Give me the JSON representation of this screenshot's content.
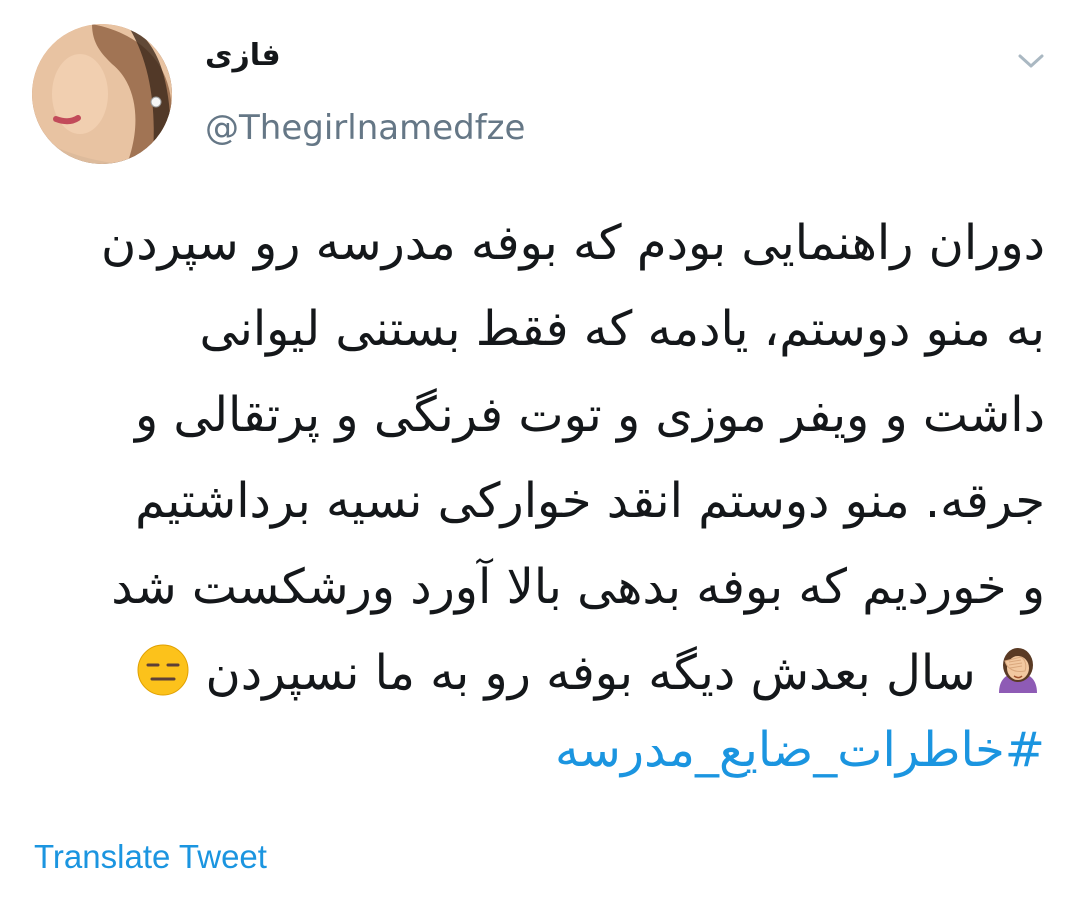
{
  "user": {
    "display_name": "فازی",
    "handle": "@Thegirlnamedfze"
  },
  "tweet": {
    "lines": [
      "دوران راهنمایی بودم که بوفه مدرسه رو سپردن",
      "به منو دوستم، یادمه که فقط بستنی  لیوانی",
      "داشت و ویفر موزی و توت فرنگی و پرتقالی و",
      "جرقه. منو دوستم انقد خوارکی نسیه برداشتیم",
      "و خوردیم که بوفه بدهی بالا آورد ورشکست شد",
      "سال بعدش دیگه بوفه رو به ما نسپردن"
    ],
    "hashtag": "#خاطرات_ضایع_مدرسه",
    "translate_label": "Translate Tweet"
  },
  "icons": {
    "caret": "chevron-down-icon",
    "facepalm": "woman-facepalming-emoji",
    "expressionless": "expressionless-face-emoji"
  },
  "colors": {
    "text": "#14171a",
    "secondary": "#657786",
    "link": "#1b95e0",
    "caret": "#aab8c2"
  }
}
